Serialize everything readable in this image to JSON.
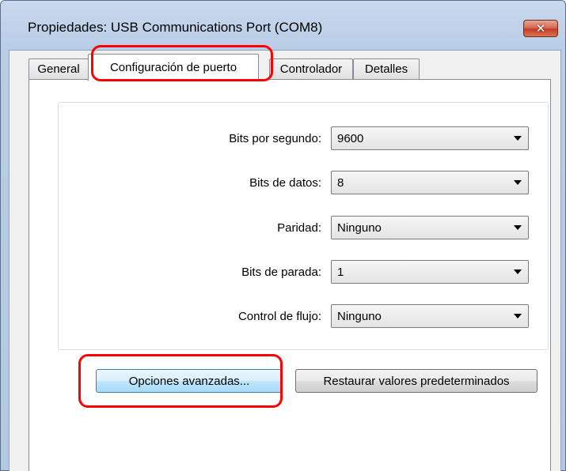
{
  "window": {
    "title": "Propiedades: USB Communications Port (COM8)",
    "close_glyph": "✕"
  },
  "tabs": [
    {
      "label": "General",
      "active": false
    },
    {
      "label": "Configuración de puerto",
      "active": true
    },
    {
      "label": "Controlador",
      "active": false
    },
    {
      "label": "Detalles",
      "active": false
    }
  ],
  "port_settings": {
    "bits_per_second": {
      "label": "Bits por segundo:",
      "value": "9600"
    },
    "data_bits": {
      "label": "Bits de datos:",
      "value": "8"
    },
    "parity": {
      "label": "Paridad:",
      "value": "Ninguno"
    },
    "stop_bits": {
      "label": "Bits de parada:",
      "value": "1"
    },
    "flow_control": {
      "label": "Control de flujo:",
      "value": "Ninguno"
    }
  },
  "buttons": {
    "advanced": "Opciones avanzadas...",
    "restore_defaults": "Restaurar valores predeterminados"
  },
  "annotation": {
    "highlight_color": "#ff0000"
  }
}
